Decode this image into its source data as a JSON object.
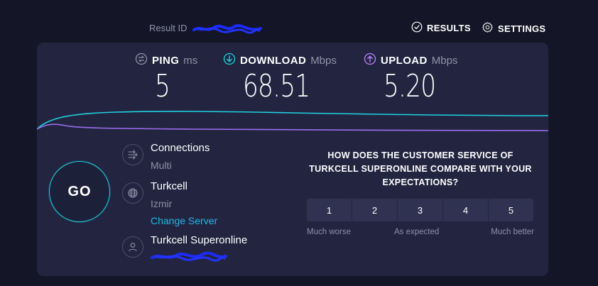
{
  "header": {
    "result_label": "Result ID",
    "results_label": "RESULTS",
    "settings_label": "SETTINGS"
  },
  "metrics": {
    "ping": {
      "name": "PING",
      "unit": "ms",
      "value": "5",
      "icon": "ping-icon",
      "color": "#9193a8"
    },
    "download": {
      "name": "DOWNLOAD",
      "unit": "Mbps",
      "value": "68.51",
      "icon": "download-icon",
      "color": "#1fd1e0"
    },
    "upload": {
      "name": "UPLOAD",
      "unit": "Mbps",
      "value": "5.20",
      "icon": "upload-icon",
      "color": "#b984ff"
    }
  },
  "go_label": "GO",
  "connections": {
    "title": "Connections",
    "value": "Multi",
    "icon": "connections-icon"
  },
  "isp": {
    "title": "Turkcell",
    "location": "Izmir",
    "change_server": "Change Server",
    "icon": "globe-icon"
  },
  "server": {
    "title": "Turkcell Superonline",
    "icon": "user-icon"
  },
  "survey": {
    "question": "HOW DOES THE CUSTOMER SERVICE OF TURKCELL SUPERONLINE COMPARE WITH YOUR EXPECTATIONS?",
    "options": [
      "1",
      "2",
      "3",
      "4",
      "5"
    ],
    "low_label": "Much worse",
    "mid_label": "As expected",
    "high_label": "Much better"
  },
  "colors": {
    "background": "#141526",
    "panel": "#232540",
    "download_accent": "#1fd1e0",
    "upload_accent": "#b984ff",
    "link": "#1fb7ea"
  }
}
